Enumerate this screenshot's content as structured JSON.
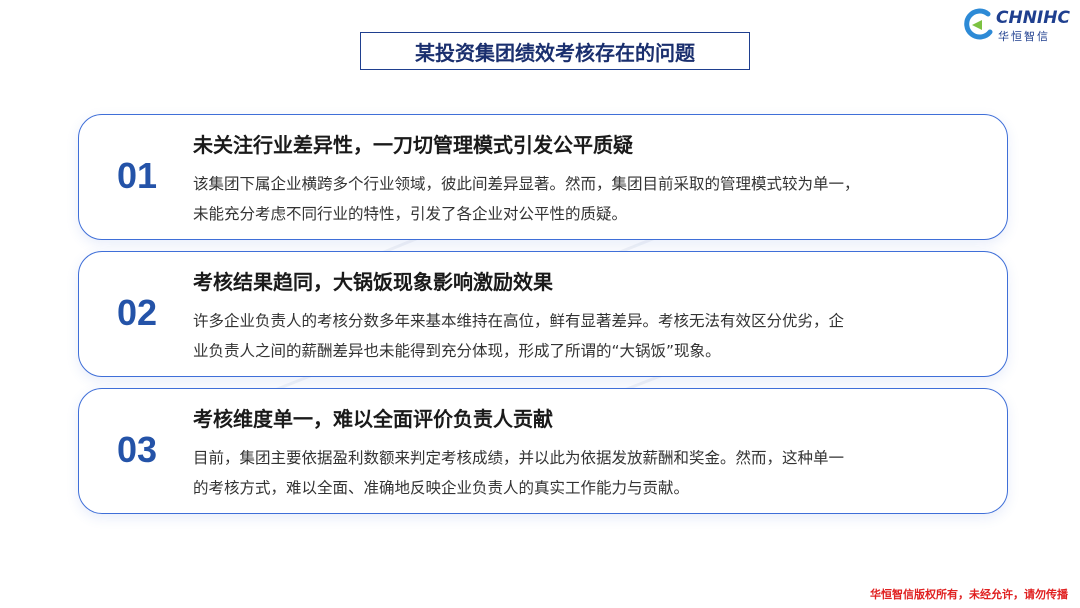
{
  "logo": {
    "name": "CHNIHC",
    "subtitle": "华恒智信"
  },
  "title": "某投资集团绩效考核存在的问题",
  "items": [
    {
      "number": "01",
      "heading": "未关注行业差异性，一刀切管理模式引发公平质疑",
      "body_line1": "该集团下属企业横跨多个行业领域，彼此间差异显著。然而，集团目前采取的管理模式较为单一，",
      "body_line2": "未能充分考虑不同行业的特性，引发了各企业对公平性的质疑。"
    },
    {
      "number": "02",
      "heading": "考核结果趋同，大锅饭现象影响激励效果",
      "body_line1": "许多企业负责人的考核分数多年来基本维持在高位，鲜有显著差异。考核无法有效区分优劣，企",
      "body_line2": "业负责人之间的薪酬差异也未能得到充分体现，形成了所谓的“大锅饭”现象。"
    },
    {
      "number": "03",
      "heading": "考核维度单一，难以全面评价负责人贡献",
      "body_line1": "目前，集团主要依据盈利数额来判定考核成绩，并以此为依据发放薪酬和奖金。然而，这种单一",
      "body_line2": "的考核方式，难以全面、准确地反映企业负责人的真实工作能力与贡献。"
    }
  ],
  "footer": "华恒智信版权所有，未经允许，请勿传播",
  "colors": {
    "accent": "#2453a8",
    "card_border": "#3f6fd8",
    "footer": "#e02020"
  }
}
